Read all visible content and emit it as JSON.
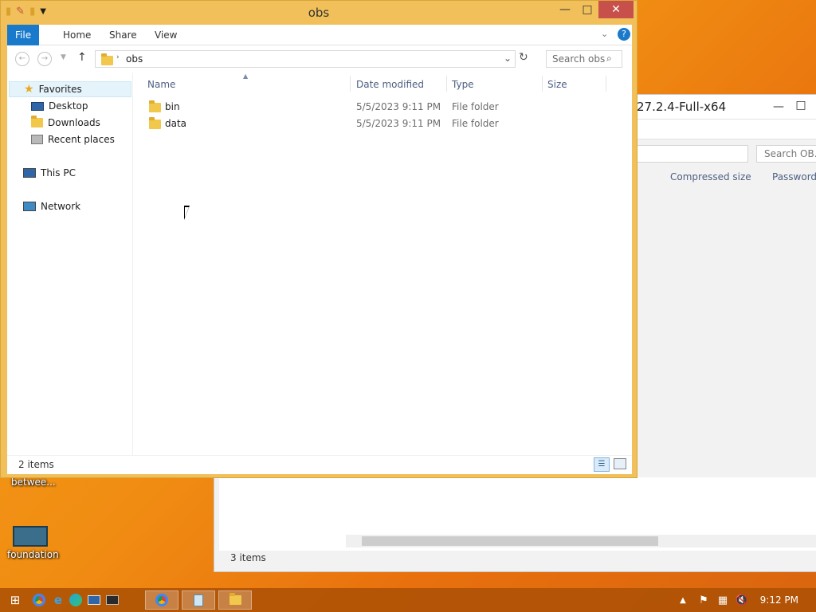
{
  "desktop": {
    "icon1_label": "betwee...",
    "icon2_label": "foundation"
  },
  "bg_window": {
    "title": "27.2.4-Full-x64",
    "search_placeholder": "Search OB...",
    "col_compressed": "Compressed size",
    "col_password": "Password ...",
    "status": "3 items"
  },
  "window": {
    "title": "obs",
    "tabs": [
      "File",
      "Home",
      "Share",
      "View"
    ],
    "address": "obs",
    "search_placeholder": "Search obs",
    "nav": {
      "favorites": "Favorites",
      "desktop": "Desktop",
      "downloads": "Downloads",
      "recent": "Recent places",
      "thispc": "This PC",
      "network": "Network"
    },
    "columns": [
      "Name",
      "Date modified",
      "Type",
      "Size"
    ],
    "files": [
      {
        "name": "bin",
        "date": "5/5/2023 9:11 PM",
        "type": "File folder"
      },
      {
        "name": "data",
        "date": "5/5/2023 9:11 PM",
        "type": "File folder"
      }
    ],
    "status": "2 items"
  },
  "taskbar": {
    "clock": "9:12 PM"
  }
}
